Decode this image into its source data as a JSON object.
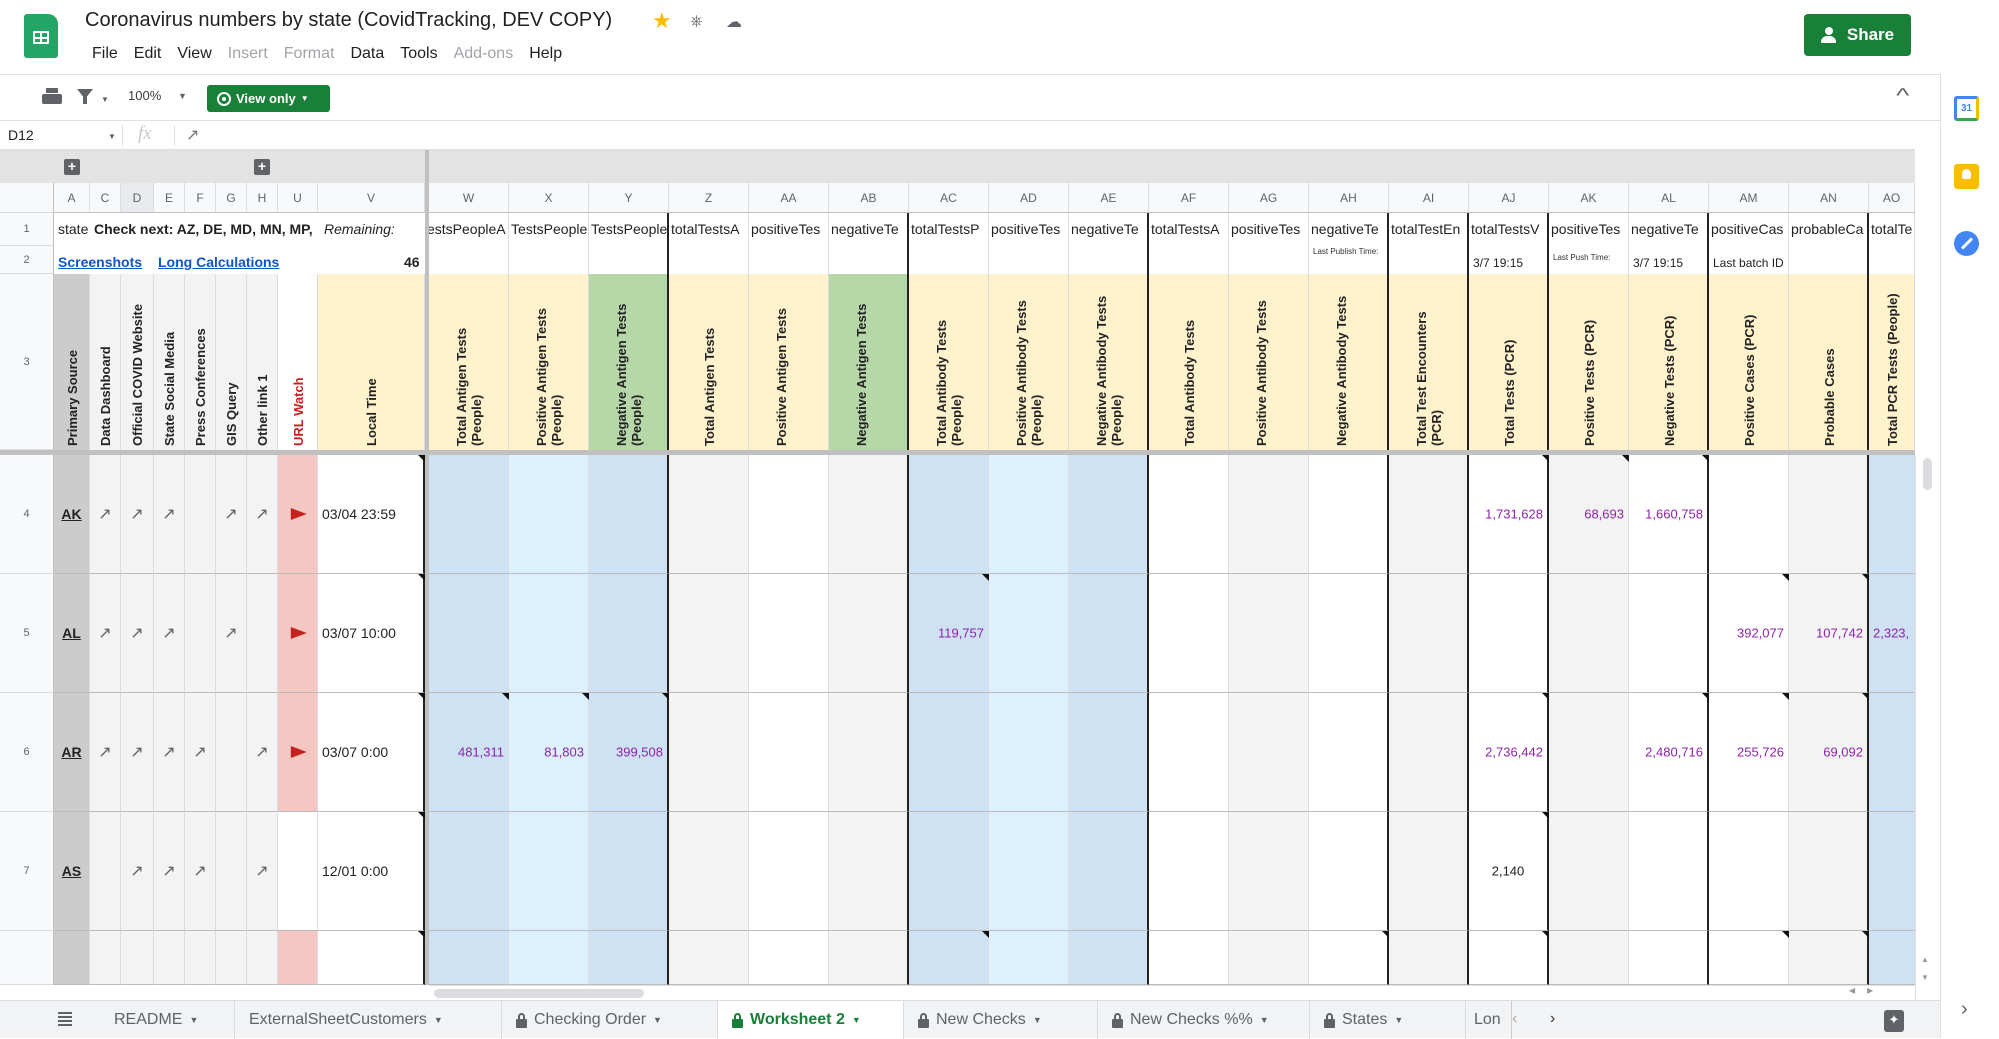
{
  "app": {
    "doc_title": "Coronavirus numbers by state (CovidTracking, DEV COPY)",
    "menu": [
      {
        "label": "File",
        "enabled": true
      },
      {
        "label": "Edit",
        "enabled": true
      },
      {
        "label": "View",
        "enabled": true
      },
      {
        "label": "Insert",
        "enabled": false
      },
      {
        "label": "Format",
        "enabled": false
      },
      {
        "label": "Data",
        "enabled": true
      },
      {
        "label": "Tools",
        "enabled": true
      },
      {
        "label": "Add-ons",
        "enabled": false
      },
      {
        "label": "Help",
        "enabled": true
      }
    ],
    "share_label": "Share",
    "colors": {
      "brand_green": "#188038",
      "value_purple": "#8e24aa",
      "flag_red": "#c5221f"
    }
  },
  "toolbar": {
    "zoom": "100%",
    "view_only_label": "View only"
  },
  "formula_bar": {
    "cell_ref": "D12",
    "fx": "fx",
    "value": "↗"
  },
  "side_panel": {
    "calendar_day": "31"
  },
  "grid": {
    "column_letters": [
      "A",
      "C",
      "D",
      "E",
      "F",
      "G",
      "H",
      "U",
      "V",
      "W",
      "X",
      "Y",
      "Z",
      "AA",
      "AB",
      "AC",
      "AD",
      "AE",
      "AF",
      "AG",
      "AH",
      "AI",
      "AJ",
      "AK",
      "AL",
      "AM",
      "AN",
      "AO"
    ],
    "row_numbers": [
      "1",
      "2",
      "3",
      "4",
      "5",
      "6",
      "7"
    ],
    "row1": {
      "A": "state",
      "C": "Check next: AZ, DE, MD, MN, MP,",
      "V": "Remaining:",
      "W": "estsPeopleA",
      "X": "TestsPeople",
      "Y": "TestsPeople",
      "Z": "totalTestsA",
      "AA": "positiveTes",
      "AB": "negativeTe",
      "AC": "totalTestsP",
      "AD": "positiveTes",
      "AE": "negativeTe",
      "AF": "totalTestsA",
      "AG": "positiveTes",
      "AH": "negativeTe",
      "AI": "totalTestEn",
      "AJ": "totalTestsV",
      "AK": "positiveTes",
      "AL": "negativeTe",
      "AM": "positiveCas",
      "AN": "probableCa",
      "AO": "totalTe"
    },
    "row2": {
      "screenshots_link": "Screenshots",
      "long_calc_link": "Long Calculations",
      "remaining_count": "46",
      "AH": "Last Publish Time:",
      "AJ": "3/7 19:15",
      "AK": "Last Push Time:",
      "AL": "3/7 19:15",
      "AM": "Last batch ID"
    },
    "headers": {
      "A": "Primary Source",
      "C": "Data Dashboard",
      "D": "Official COVID Website",
      "E": "State Social Media",
      "F": "Press Conferences",
      "G": "GIS Query",
      "H": "Other link 1",
      "U": "URL Watch",
      "V": "Local Time",
      "W": "Total Antigen Tests (People)",
      "X": "Positive Antigen Tests (People)",
      "Y": "Negative Antigen Tests (People)",
      "Z": "Total Antigen Tests",
      "AA": "Positive Antigen Tests",
      "AB": "Negative Antigen Tests",
      "AC": "Total Antibody Tests (People)",
      "AD": "Positive Antibody Tests (People)",
      "AE": "Negative Antibody Tests (People)",
      "AF": "Total Antibody Tests",
      "AG": "Positive Antibody Tests",
      "AH": "Negative Antibody Tests",
      "AI": "Total Test Encounters (PCR)",
      "AJ": "Total Tests (PCR)",
      "AK": "Positive Tests (PCR)",
      "AL": "Negative Tests (PCR)",
      "AM": "Positive Cases (PCR)",
      "AN": "Probable Cases",
      "AO": "Total PCR Tests (People)"
    },
    "rows": [
      {
        "row": "4",
        "state": "AK",
        "links": {
          "C": "↗",
          "D": "↗",
          "E": "↗",
          "F": "",
          "G": "↗",
          "H": "↗"
        },
        "url_watch_flag": true,
        "local_time": "03/04 23:59",
        "values": {
          "AJ": "1,731,628",
          "AK": "68,693",
          "AL": "1,660,758"
        }
      },
      {
        "row": "5",
        "state": "AL",
        "links": {
          "C": "↗",
          "D": "↗",
          "E": "↗",
          "F": "",
          "G": "↗",
          "H": ""
        },
        "url_watch_flag": true,
        "local_time": "03/07 10:00",
        "values": {
          "AC": "119,757",
          "AM": "392,077",
          "AN": "107,742",
          "AO": "2,323,"
        }
      },
      {
        "row": "6",
        "state": "AR",
        "links": {
          "C": "↗",
          "D": "↗",
          "E": "↗",
          "F": "↗",
          "G": "",
          "H": "↗"
        },
        "url_watch_flag": true,
        "local_time": "03/07 0:00",
        "values": {
          "W": "481,311",
          "X": "81,803",
          "Y": "399,508",
          "AJ": "2,736,442",
          "AL": "2,480,716",
          "AM": "255,726",
          "AN": "69,092"
        }
      },
      {
        "row": "7",
        "state": "AS",
        "links": {
          "C": "",
          "D": "↗",
          "E": "↗",
          "F": "↗",
          "G": "",
          "H": "↗"
        },
        "url_watch_flag": false,
        "local_time": "12/01 0:00",
        "values": {
          "AJ": "2,140"
        }
      }
    ]
  },
  "sheet_tabs": [
    {
      "label": "README",
      "locked": false,
      "active": false
    },
    {
      "label": "ExternalSheetCustomers",
      "locked": false,
      "active": false
    },
    {
      "label": "Checking Order",
      "locked": true,
      "active": false
    },
    {
      "label": "Worksheet 2",
      "locked": true,
      "active": true
    },
    {
      "label": "New Checks",
      "locked": true,
      "active": false
    },
    {
      "label": "New Checks %%",
      "locked": true,
      "active": false
    },
    {
      "label": "States",
      "locked": true,
      "active": false
    },
    {
      "label": "Lon",
      "locked": false,
      "active": false
    }
  ]
}
